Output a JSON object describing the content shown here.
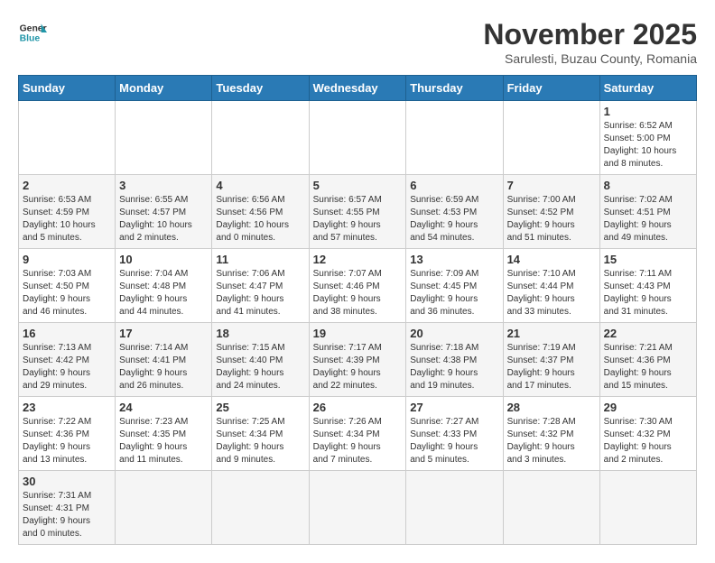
{
  "header": {
    "logo_general": "General",
    "logo_blue": "Blue",
    "month_year": "November 2025",
    "location": "Sarulesti, Buzau County, Romania"
  },
  "days_of_week": [
    "Sunday",
    "Monday",
    "Tuesday",
    "Wednesday",
    "Thursday",
    "Friday",
    "Saturday"
  ],
  "weeks": [
    [
      {
        "day": "",
        "info": ""
      },
      {
        "day": "",
        "info": ""
      },
      {
        "day": "",
        "info": ""
      },
      {
        "day": "",
        "info": ""
      },
      {
        "day": "",
        "info": ""
      },
      {
        "day": "",
        "info": ""
      },
      {
        "day": "1",
        "info": "Sunrise: 6:52 AM\nSunset: 5:00 PM\nDaylight: 10 hours\nand 8 minutes."
      }
    ],
    [
      {
        "day": "2",
        "info": "Sunrise: 6:53 AM\nSunset: 4:59 PM\nDaylight: 10 hours\nand 5 minutes."
      },
      {
        "day": "3",
        "info": "Sunrise: 6:55 AM\nSunset: 4:57 PM\nDaylight: 10 hours\nand 2 minutes."
      },
      {
        "day": "4",
        "info": "Sunrise: 6:56 AM\nSunset: 4:56 PM\nDaylight: 10 hours\nand 0 minutes."
      },
      {
        "day": "5",
        "info": "Sunrise: 6:57 AM\nSunset: 4:55 PM\nDaylight: 9 hours\nand 57 minutes."
      },
      {
        "day": "6",
        "info": "Sunrise: 6:59 AM\nSunset: 4:53 PM\nDaylight: 9 hours\nand 54 minutes."
      },
      {
        "day": "7",
        "info": "Sunrise: 7:00 AM\nSunset: 4:52 PM\nDaylight: 9 hours\nand 51 minutes."
      },
      {
        "day": "8",
        "info": "Sunrise: 7:02 AM\nSunset: 4:51 PM\nDaylight: 9 hours\nand 49 minutes."
      }
    ],
    [
      {
        "day": "9",
        "info": "Sunrise: 7:03 AM\nSunset: 4:50 PM\nDaylight: 9 hours\nand 46 minutes."
      },
      {
        "day": "10",
        "info": "Sunrise: 7:04 AM\nSunset: 4:48 PM\nDaylight: 9 hours\nand 44 minutes."
      },
      {
        "day": "11",
        "info": "Sunrise: 7:06 AM\nSunset: 4:47 PM\nDaylight: 9 hours\nand 41 minutes."
      },
      {
        "day": "12",
        "info": "Sunrise: 7:07 AM\nSunset: 4:46 PM\nDaylight: 9 hours\nand 38 minutes."
      },
      {
        "day": "13",
        "info": "Sunrise: 7:09 AM\nSunset: 4:45 PM\nDaylight: 9 hours\nand 36 minutes."
      },
      {
        "day": "14",
        "info": "Sunrise: 7:10 AM\nSunset: 4:44 PM\nDaylight: 9 hours\nand 33 minutes."
      },
      {
        "day": "15",
        "info": "Sunrise: 7:11 AM\nSunset: 4:43 PM\nDaylight: 9 hours\nand 31 minutes."
      }
    ],
    [
      {
        "day": "16",
        "info": "Sunrise: 7:13 AM\nSunset: 4:42 PM\nDaylight: 9 hours\nand 29 minutes."
      },
      {
        "day": "17",
        "info": "Sunrise: 7:14 AM\nSunset: 4:41 PM\nDaylight: 9 hours\nand 26 minutes."
      },
      {
        "day": "18",
        "info": "Sunrise: 7:15 AM\nSunset: 4:40 PM\nDaylight: 9 hours\nand 24 minutes."
      },
      {
        "day": "19",
        "info": "Sunrise: 7:17 AM\nSunset: 4:39 PM\nDaylight: 9 hours\nand 22 minutes."
      },
      {
        "day": "20",
        "info": "Sunrise: 7:18 AM\nSunset: 4:38 PM\nDaylight: 9 hours\nand 19 minutes."
      },
      {
        "day": "21",
        "info": "Sunrise: 7:19 AM\nSunset: 4:37 PM\nDaylight: 9 hours\nand 17 minutes."
      },
      {
        "day": "22",
        "info": "Sunrise: 7:21 AM\nSunset: 4:36 PM\nDaylight: 9 hours\nand 15 minutes."
      }
    ],
    [
      {
        "day": "23",
        "info": "Sunrise: 7:22 AM\nSunset: 4:36 PM\nDaylight: 9 hours\nand 13 minutes."
      },
      {
        "day": "24",
        "info": "Sunrise: 7:23 AM\nSunset: 4:35 PM\nDaylight: 9 hours\nand 11 minutes."
      },
      {
        "day": "25",
        "info": "Sunrise: 7:25 AM\nSunset: 4:34 PM\nDaylight: 9 hours\nand 9 minutes."
      },
      {
        "day": "26",
        "info": "Sunrise: 7:26 AM\nSunset: 4:34 PM\nDaylight: 9 hours\nand 7 minutes."
      },
      {
        "day": "27",
        "info": "Sunrise: 7:27 AM\nSunset: 4:33 PM\nDaylight: 9 hours\nand 5 minutes."
      },
      {
        "day": "28",
        "info": "Sunrise: 7:28 AM\nSunset: 4:32 PM\nDaylight: 9 hours\nand 3 minutes."
      },
      {
        "day": "29",
        "info": "Sunrise: 7:30 AM\nSunset: 4:32 PM\nDaylight: 9 hours\nand 2 minutes."
      }
    ],
    [
      {
        "day": "30",
        "info": "Sunrise: 7:31 AM\nSunset: 4:31 PM\nDaylight: 9 hours\nand 0 minutes."
      },
      {
        "day": "",
        "info": ""
      },
      {
        "day": "",
        "info": ""
      },
      {
        "day": "",
        "info": ""
      },
      {
        "day": "",
        "info": ""
      },
      {
        "day": "",
        "info": ""
      },
      {
        "day": "",
        "info": ""
      }
    ]
  ]
}
